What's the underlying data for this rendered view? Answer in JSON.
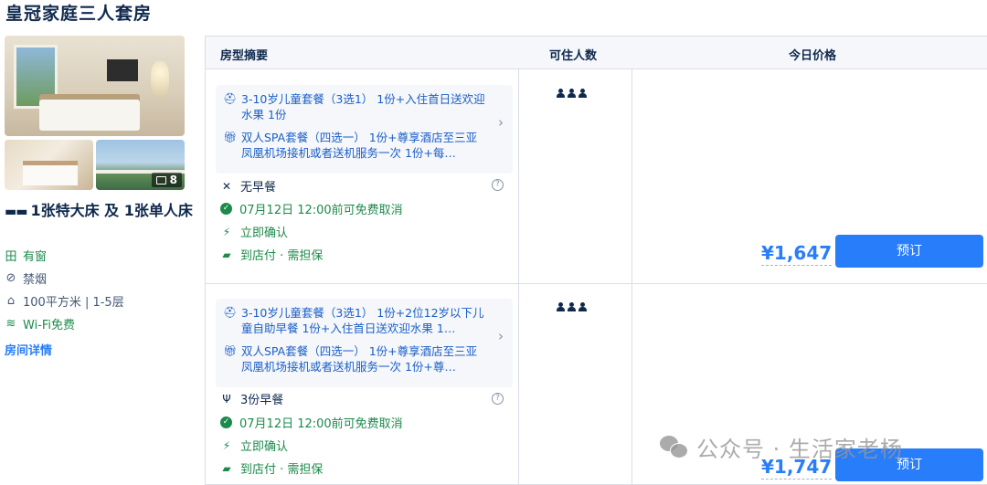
{
  "room_title": "皇冠家庭三人套房",
  "photos": {
    "count": "8"
  },
  "bed_type": "1张特大床 及 1张单人床",
  "features": [
    {
      "icon": "window-icon",
      "label": "有窗"
    },
    {
      "icon": "no-smoking-icon",
      "label": "禁烟"
    },
    {
      "icon": "floor-area-icon",
      "label": "100平方米 | 1-5层"
    },
    {
      "icon": "wifi-icon",
      "label": "Wi-Fi免费"
    }
  ],
  "room_detail_link": "房间详情",
  "table_headers": {
    "summary": "房型摘要",
    "occupancy": "可住人数",
    "price_today": "今日价格"
  },
  "offers": [
    {
      "packages": [
        {
          "icon": "room-service-icon",
          "text": "3-10岁儿童套餐（3选1） 1份+入住首日送欢迎水果 1份"
        },
        {
          "icon": "gift-icon",
          "text": "双人SPA套餐（四选一） 1份+尊享酒店至三亚凤凰机场接机或者送机服务一次 1份+每…"
        }
      ],
      "meal": "无早餐",
      "cancel": "07月12日 12:00前可免费取消",
      "confirm": "立即确认",
      "payment": "到店付 · 需担保",
      "price": "¥1,647",
      "book_label": "预订"
    },
    {
      "packages": [
        {
          "icon": "room-service-icon",
          "text": "3-10岁儿童套餐（3选1） 1份+2位12岁以下儿童自助早餐 1份+入住首日送欢迎水果 1…"
        },
        {
          "icon": "gift-icon",
          "text": "双人SPA套餐（四选一） 1份+尊享酒店至三亚凤凰机场接机或者送机服务一次 1份+尊…"
        }
      ],
      "meal": "3份早餐",
      "cancel": "07月12日 12:00前可免费取消",
      "confirm": "立即确认",
      "payment": "到店付 · 需担保",
      "price": "¥1,747",
      "book_label": "预订"
    }
  ],
  "watermark": "公众号 · 生活家老杨",
  "colors": {
    "accent": "#287dfa",
    "green": "#1b8a4a",
    "text": "#0f294d"
  }
}
